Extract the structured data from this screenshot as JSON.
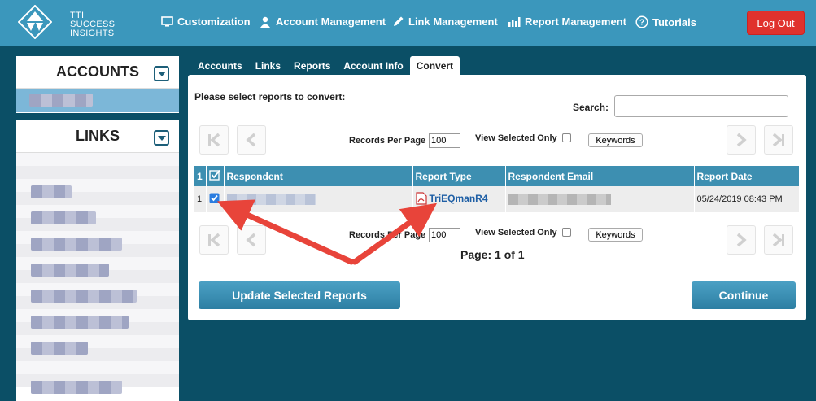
{
  "brand": {
    "line1": "TTI",
    "line2": "SUCCESS",
    "line3": "INSIGHTS"
  },
  "nav": {
    "customization": "Customization",
    "account_management": "Account Management",
    "link_management": "Link Management",
    "report_management": "Report Management",
    "tutorials": "Tutorials",
    "logout": "Log Out"
  },
  "sidebar": {
    "accounts_title": "ACCOUNTS",
    "links_title": "LINKS"
  },
  "tabs": [
    {
      "label": "Accounts"
    },
    {
      "label": "Links"
    },
    {
      "label": "Reports"
    },
    {
      "label": "Account Info"
    },
    {
      "label": "Convert"
    }
  ],
  "convert": {
    "instruction": "Please select reports to convert:",
    "search_label": "Search:",
    "records_per_page_label": "Records Per Page",
    "records_per_page_value": "100",
    "view_selected_only": "View Selected Only",
    "keywords_button": "Keywords",
    "page_info": "Page: 1 of 1",
    "update_button": "Update Selected Reports",
    "continue_button": "Continue"
  },
  "table": {
    "headers": {
      "num": "1",
      "respondent": "Respondent",
      "report_type": "Report Type",
      "email": "Respondent Email",
      "date": "Report Date"
    },
    "rows": [
      {
        "num": "1",
        "report_type": "TriEQmanR4",
        "date": "05/24/2019 08:43 PM"
      }
    ]
  },
  "colors": {
    "topbar": "#3b97bc",
    "background": "#0b4f66",
    "accent": "#2d7fa3",
    "logout": "#e0322d",
    "arrow": "#e8443a"
  }
}
